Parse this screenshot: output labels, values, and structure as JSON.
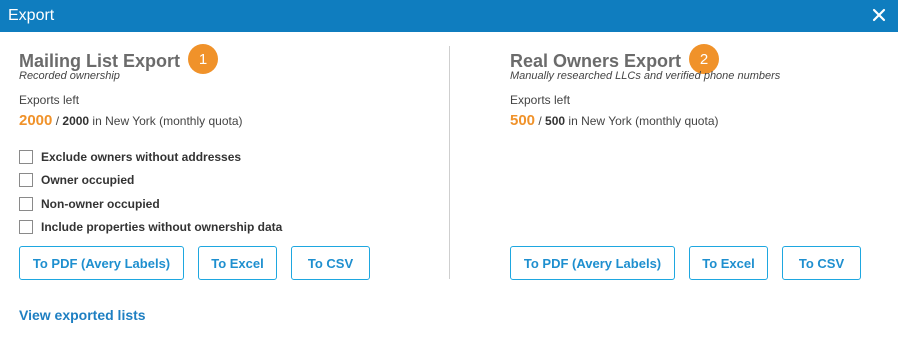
{
  "window": {
    "title": "Export",
    "close_icon": "close-icon"
  },
  "mailing": {
    "title": "Mailing List Export",
    "step": "1",
    "subtitle": "Recorded ownership",
    "exports_left_label": "Exports left",
    "quota_used": "2000",
    "quota_separator": " / ",
    "quota_total": "2000",
    "quota_suffix": " in New York (monthly quota)",
    "options": [
      {
        "label": "Exclude owners without addresses",
        "checked": false
      },
      {
        "label": "Owner occupied",
        "checked": false
      },
      {
        "label": "Non-owner occupied",
        "checked": false
      },
      {
        "label": "Include properties without ownership data",
        "checked": false
      }
    ],
    "buttons": {
      "pdf": "To PDF (Avery Labels)",
      "excel": "To Excel",
      "csv": "To CSV"
    }
  },
  "real_owners": {
    "title": "Real Owners Export",
    "step": "2",
    "subtitle": "Manually researched LLCs and verified phone numbers",
    "exports_left_label": "Exports left",
    "quota_used": "500",
    "quota_separator": " / ",
    "quota_total": "500",
    "quota_suffix": " in New York (monthly quota)",
    "buttons": {
      "pdf": "To PDF (Avery Labels)",
      "excel": "To Excel",
      "csv": "To CSV"
    }
  },
  "footer": {
    "view_exported_link": "View exported lists"
  },
  "colors": {
    "titlebar": "#0f7dbf",
    "accent_orange": "#f0922a",
    "button_border": "#1ea7e0",
    "link": "#1e7fc2"
  }
}
